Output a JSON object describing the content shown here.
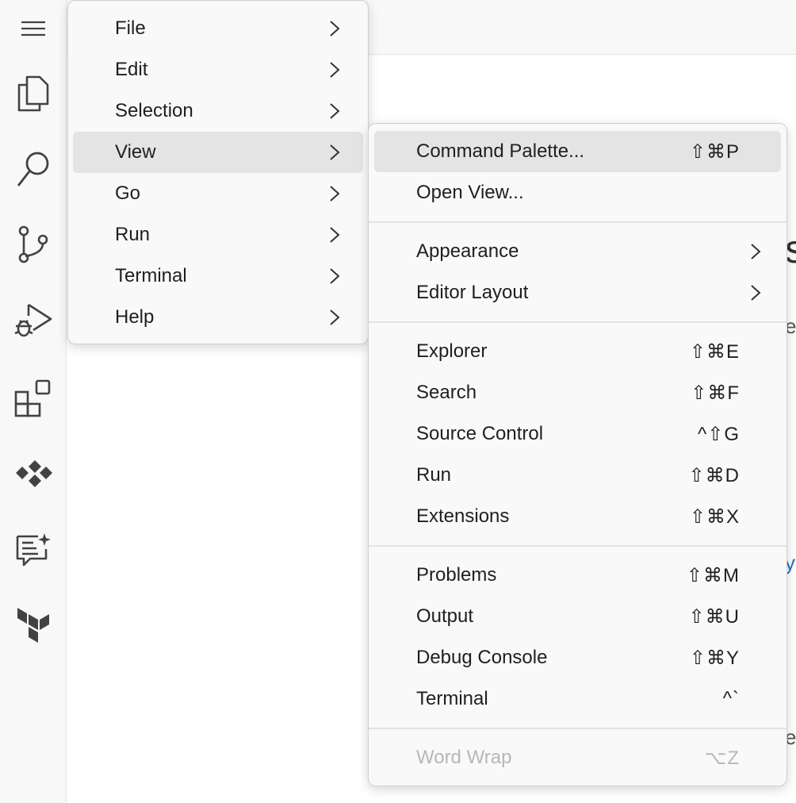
{
  "activity_bar": {
    "icons": [
      "menu-icon",
      "files-icon",
      "search-icon",
      "source-control-icon",
      "run-debug-icon",
      "extensions-icon",
      "diamonds-icon",
      "chat-sparkle-icon",
      "terraform-icon"
    ]
  },
  "editor_peek": {
    "big_letter": "s",
    "letter_e1": "e",
    "letter_y": "y",
    "letter_e2": "e"
  },
  "main_menu": {
    "items": [
      {
        "label": "File"
      },
      {
        "label": "Edit"
      },
      {
        "label": "Selection"
      },
      {
        "label": "View"
      },
      {
        "label": "Go"
      },
      {
        "label": "Run"
      },
      {
        "label": "Terminal"
      },
      {
        "label": "Help"
      }
    ]
  },
  "view_menu": {
    "command_palette": {
      "label": "Command Palette...",
      "shortcut": "⇧⌘P"
    },
    "open_view": {
      "label": "Open View..."
    },
    "appearance": {
      "label": "Appearance"
    },
    "editor_layout": {
      "label": "Editor Layout"
    },
    "explorer": {
      "label": "Explorer",
      "shortcut": "⇧⌘E"
    },
    "search": {
      "label": "Search",
      "shortcut": "⇧⌘F"
    },
    "source_control": {
      "label": "Source Control",
      "shortcut": "^⇧G"
    },
    "run": {
      "label": "Run",
      "shortcut": "⇧⌘D"
    },
    "extensions": {
      "label": "Extensions",
      "shortcut": "⇧⌘X"
    },
    "problems": {
      "label": "Problems",
      "shortcut": "⇧⌘M"
    },
    "output": {
      "label": "Output",
      "shortcut": "⇧⌘U"
    },
    "debug_console": {
      "label": "Debug Console",
      "shortcut": "⇧⌘Y"
    },
    "terminal": {
      "label": "Terminal",
      "shortcut": "^`"
    },
    "word_wrap": {
      "label": "Word Wrap",
      "shortcut": "⌥Z"
    }
  }
}
